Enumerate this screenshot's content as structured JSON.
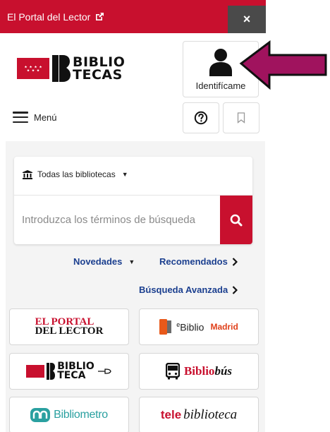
{
  "topbar": {
    "portal_link": "El Portal del Lector",
    "external_icon": "external-link-icon",
    "close_label": "×"
  },
  "logo": {
    "line1": "BIBLIO",
    "line2": "TECAS"
  },
  "account": {
    "identify_label": "Identifícame",
    "icon": "user-icon"
  },
  "menu": {
    "label": "Menú",
    "icon": "hamburger-icon",
    "help_icon": "help-circle-icon",
    "bookmark_icon": "bookmark-icon"
  },
  "search": {
    "library_select": "Todas las bibliotecas",
    "library_icon": "library-building-icon",
    "placeholder": "Introduzca los términos de búsqueda",
    "button_icon": "search-icon"
  },
  "links": {
    "novedades": "Novedades",
    "recomendados": "Recomendados",
    "busqueda_avanzada": "Búsqueda Avanzada"
  },
  "tiles": {
    "portal_l1": "EL PORTAL",
    "portal_l2": "DEL LECTOR",
    "ebiblio_e": "e",
    "ebiblio_name": "Biblio",
    "ebiblio_madrid": "Madrid",
    "biblioteca_l1": "BIBLIO",
    "biblioteca_l2": "TECA",
    "bibliobus_1": "Biblio",
    "bibliobus_2": "bús",
    "bibliometro": "Bibliometro",
    "tele_1": "tele",
    "tele_2": "biblioteca"
  },
  "colors": {
    "brand_red": "#c8102e",
    "link_blue": "#1b3f8f",
    "annotation_arrow": "#a0135e"
  }
}
